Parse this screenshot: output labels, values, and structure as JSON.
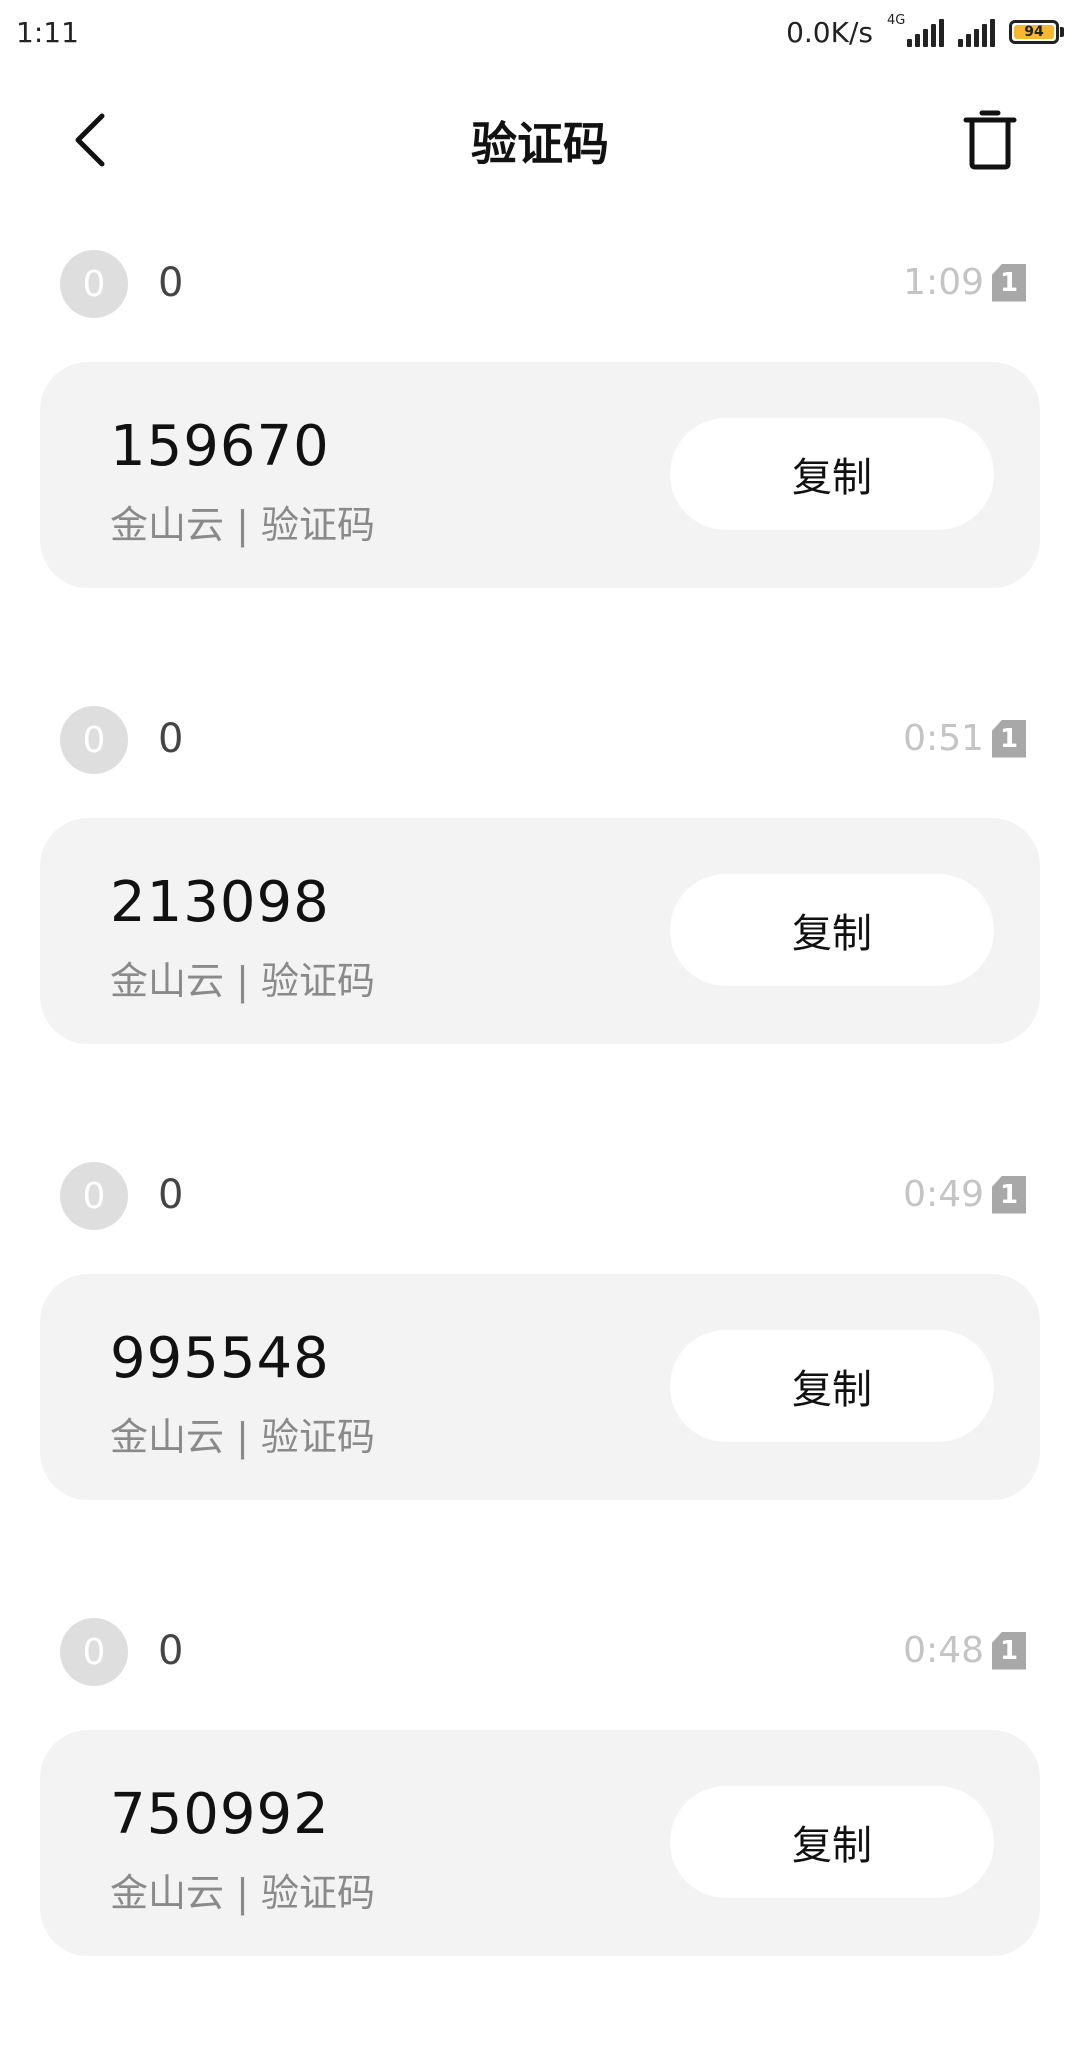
{
  "status_bar": {
    "time": "1:11",
    "net_speed": "0.0K/s",
    "net_type": "4G",
    "battery": "94"
  },
  "header": {
    "title": "验证码"
  },
  "messages": [
    {
      "avatar": "0",
      "sender": "0",
      "time": "1:09",
      "sim": "1",
      "code": "159670",
      "desc": "金山云 | 验证码",
      "copy_label": "复制"
    },
    {
      "avatar": "0",
      "sender": "0",
      "time": "0:51",
      "sim": "1",
      "code": "213098",
      "desc": "金山云 | 验证码",
      "copy_label": "复制"
    },
    {
      "avatar": "0",
      "sender": "0",
      "time": "0:49",
      "sim": "1",
      "code": "995548",
      "desc": "金山云 | 验证码",
      "copy_label": "复制"
    },
    {
      "avatar": "0",
      "sender": "0",
      "time": "0:48",
      "sim": "1",
      "code": "750992",
      "desc": "金山云 | 验证码",
      "copy_label": "复制"
    }
  ],
  "icons": {
    "back": "back-arrow-icon",
    "delete": "trash-icon"
  },
  "colors": {
    "card_bg": "#f3f3f3",
    "avatar_bg": "#dedede",
    "time_text": "#c4c4c4",
    "battery_fill": "#f5b82e"
  }
}
